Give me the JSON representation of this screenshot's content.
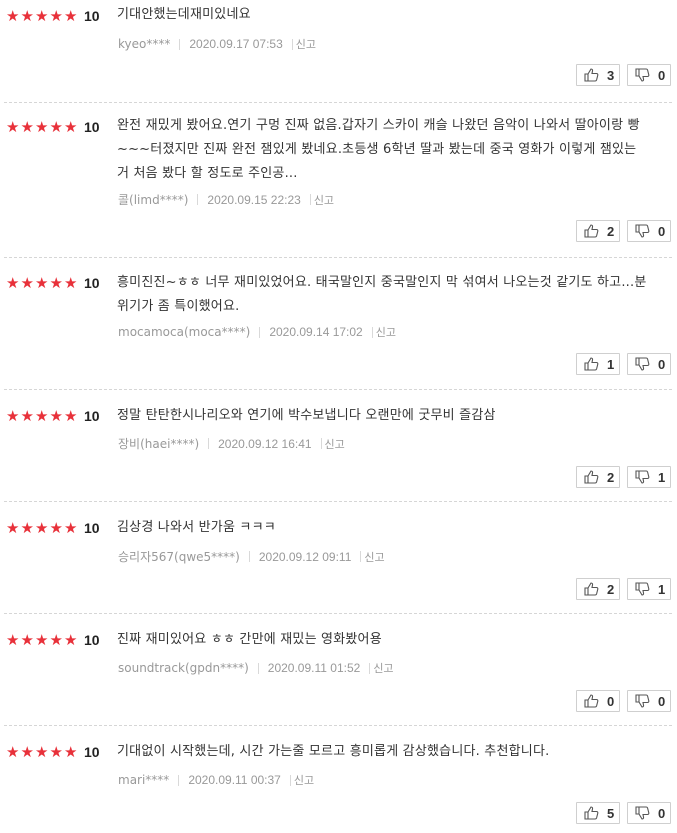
{
  "reviews": [
    {
      "score": "10",
      "text": "기대안했는데재미있네요",
      "user": "kyeo****",
      "date": "2020.09.17 07:53",
      "report": "신고",
      "likes": "3",
      "dislikes": "0"
    },
    {
      "score": "10",
      "text": "완전 재밌게 봤어요.연기 구멍 진짜 없음.갑자기 스카이 캐슬 나왔던 음악이 나와서 딸아이랑 빵~~~터졌지만 진짜 완전 잼있게 봤네요.초등생 6학년 딸과 봤는데 중국 영화가 이렇게 잼있는거 처음 봤다 할 정도로 주인공...",
      "user": "콜(limd****)",
      "date": "2020.09.15 22:23",
      "report": "신고",
      "likes": "2",
      "dislikes": "0"
    },
    {
      "score": "10",
      "text": "흥미진진~ㅎㅎ 너무 재미있었어요. 태국말인지 중국말인지 막 섞여서 나오는것 같기도 하고...분위기가 좀 특이했어요.",
      "user": "mocamoca(moca****)",
      "date": "2020.09.14 17:02",
      "report": "신고",
      "likes": "1",
      "dislikes": "0"
    },
    {
      "score": "10",
      "text": "정말 탄탄한시나리오와 연기에 박수보냅니다 오랜만에 굿무비 즐감삼",
      "user": "장비(haei****)",
      "date": "2020.09.12 16:41",
      "report": "신고",
      "likes": "2",
      "dislikes": "1"
    },
    {
      "score": "10",
      "text": "김상경 나와서 반가움 ㅋㅋㅋ",
      "user": "승리자567(qwe5****)",
      "date": "2020.09.12 09:11",
      "report": "신고",
      "likes": "2",
      "dislikes": "1"
    },
    {
      "score": "10",
      "text": "진짜 재미있어요 ㅎㅎ 간만에 재밌는 영화봤어용",
      "user": "soundtrack(gpdn****)",
      "date": "2020.09.11 01:52",
      "report": "신고",
      "likes": "0",
      "dislikes": "0"
    },
    {
      "score": "10",
      "text": "기대없이 시작했는데, 시간 가는줄 모르고 흥미롭게 감상했습니다. 추천합니다.",
      "user": "mari****",
      "date": "2020.09.11 00:37",
      "report": "신고",
      "likes": "5",
      "dislikes": "0"
    }
  ],
  "icons": {
    "star": "star-icon",
    "like": "thumbs-up-icon",
    "dislike": "thumbs-down-icon"
  },
  "colors": {
    "star": "#e8313a",
    "text": "#333333",
    "meta": "#999999",
    "border": "#cfcfcf"
  }
}
